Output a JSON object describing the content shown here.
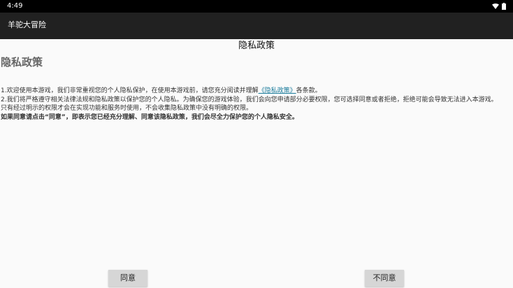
{
  "status_bar": {
    "time": "4:49",
    "icons": [
      "wifi-icon",
      "battery-icon"
    ]
  },
  "app_bar": {
    "title": "羊驼大冒险"
  },
  "page": {
    "header": "隐私政策",
    "heading": "隐私政策",
    "paragraphs": {
      "p1_before": "1.欢迎使用本游戏，我们非常重视您的个人隐私保护，在使用本游戏前，请您充分阅读并理解",
      "p1_link": "《隐私政策》",
      "p1_after": "各条款。",
      "p2": "2.我们将严格遵守相关法律法规和隐私政策以保护您的个人隐私。为确保您的游戏体验，我们会向您申请部分必要权限，您可选择同意或者拒绝，拒绝可能会导致无法进入本游戏。",
      "p3": "只有经过明示的权限才会在实现功能和服务时使用，不会收集隐私政策中没有明确的权限。",
      "p4": "如果同意请点击“同意”，即表示您已经充分理解、同意该隐私政策，我们会尽全力保护您的个人隐私安全。"
    }
  },
  "buttons": {
    "agree": "同意",
    "disagree": "不同意"
  },
  "colors": {
    "status_bar": "#000000",
    "app_bar": "#212121",
    "background": "#fafafa",
    "link": "#1a7b9b",
    "button": "#d6d6d6"
  }
}
